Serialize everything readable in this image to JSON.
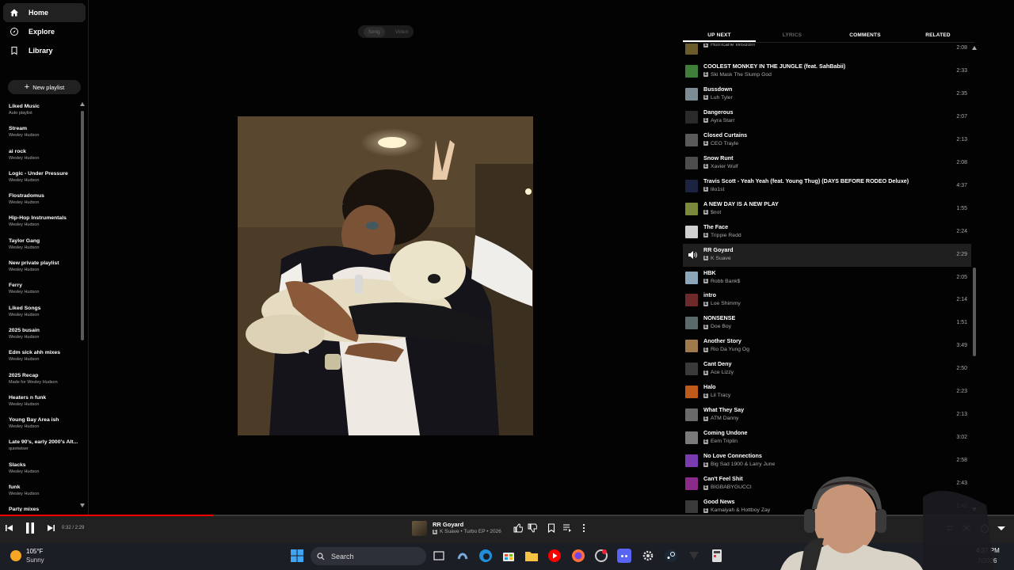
{
  "sidebar": {
    "nav": [
      {
        "label": "Home",
        "icon": "home-icon"
      },
      {
        "label": "Explore",
        "icon": "explore-icon"
      },
      {
        "label": "Library",
        "icon": "library-icon"
      }
    ],
    "new_playlist_label": "New playlist",
    "playlists": [
      {
        "title": "Liked Music",
        "subtitle": "Auto playlist"
      },
      {
        "title": "Stream",
        "subtitle": "Wesley Hudson"
      },
      {
        "title": "ai rock",
        "subtitle": "Wesley Hudson"
      },
      {
        "title": "Logic - Under Pressure",
        "subtitle": "Wesley Hudson"
      },
      {
        "title": "Flostradomus",
        "subtitle": "Wesley Hudson"
      },
      {
        "title": "Hip-Hop Instrumentals",
        "subtitle": "Wesley Hudson"
      },
      {
        "title": "Taylor Gang",
        "subtitle": "Wesley Hudson"
      },
      {
        "title": "New private playlist",
        "subtitle": "Wesley Hudson"
      },
      {
        "title": "Ferry",
        "subtitle": "Wesley Hudson"
      },
      {
        "title": "Liked Songs",
        "subtitle": "Wesley Hudson"
      },
      {
        "title": "2025 busain",
        "subtitle": "Wesley Hudson"
      },
      {
        "title": "Edm sick ahh mixes",
        "subtitle": "Wesley Hudson"
      },
      {
        "title": "2025 Recap",
        "subtitle": "Made for Wesley Hudson"
      },
      {
        "title": "Heaters n funk",
        "subtitle": "Wesley Hudson"
      },
      {
        "title": "Young Bay Area ish",
        "subtitle": "Wesley Hudson"
      },
      {
        "title": "Late 90's, early 2000's Alt...",
        "subtitle": "quietwiser"
      },
      {
        "title": "Slacks",
        "subtitle": "Wesley Hudson"
      },
      {
        "title": "funk",
        "subtitle": "Wesley Hudson"
      },
      {
        "title": "Party mixes",
        "subtitle": "Wesley Hudson"
      }
    ]
  },
  "toggle": {
    "song": "Song",
    "video": "Video"
  },
  "tabs": [
    "UP NEXT",
    "LYRICS",
    "COMMENTS",
    "RELATED"
  ],
  "queue": [
    {
      "title": "",
      "artist": "Hurricane Wisdom",
      "duration": "2:08",
      "thumb": "#6b5a2a"
    },
    {
      "title": "COOLEST MONKEY IN THE JUNGLE (feat. SahBabii)",
      "artist": "Ski Mask The Slump God",
      "duration": "2:33",
      "thumb": "#3f7f3a"
    },
    {
      "title": "Bussdown",
      "artist": "Luh Tyler",
      "duration": "2:35",
      "thumb": "#7b8c95"
    },
    {
      "title": "Dangerous",
      "artist": "Ayra Starr",
      "duration": "2:07",
      "thumb": "#2a2a2a"
    },
    {
      "title": "Closed Curtains",
      "artist": "CEO Trayle",
      "duration": "2:13",
      "thumb": "#5a5a5a"
    },
    {
      "title": "Snow Runt",
      "artist": "Xavier Wulf",
      "duration": "2:08",
      "thumb": "#4d4d4d"
    },
    {
      "title": "Travis Scott - Yeah Yeah (feat. Young Thug) (DAYS BEFORE RODEO Deluxe)",
      "artist": "lilo1st",
      "duration": "4:37",
      "thumb": "#1c2340"
    },
    {
      "title": "A NEW DAY IS A NEW PLAY",
      "artist": "$not",
      "duration": "1:55",
      "thumb": "#7a8a3a"
    },
    {
      "title": "The Face",
      "artist": "Trippie Redd",
      "duration": "2:24",
      "thumb": "#cfcfcf"
    },
    {
      "title": "RR Goyard",
      "artist": "K Suave",
      "duration": "2:29",
      "thumb": "#1f1f1f"
    },
    {
      "title": "HBK",
      "artist": "Robb Bank$",
      "duration": "2:05",
      "thumb": "#8aa6b8"
    },
    {
      "title": "intro",
      "artist": "Loe Shimmy",
      "duration": "2:14",
      "thumb": "#6e2a2a"
    },
    {
      "title": "NONSENSE",
      "artist": "Doe Boy",
      "duration": "1:51",
      "thumb": "#5a6a6a"
    },
    {
      "title": "Another Story",
      "artist": "Rio Da Yung Og",
      "duration": "3:49",
      "thumb": "#a07a4a"
    },
    {
      "title": "Cant Deny",
      "artist": "Ace Lizzy",
      "duration": "2:50",
      "thumb": "#3a3a3a"
    },
    {
      "title": "Halo",
      "artist": "Lil Tracy",
      "duration": "2:23",
      "thumb": "#c05a1a"
    },
    {
      "title": "What They Say",
      "artist": "ATM Danny",
      "duration": "2:13",
      "thumb": "#6a6a6a"
    },
    {
      "title": "Coming Undone",
      "artist": "Eem Triplin",
      "duration": "3:02",
      "thumb": "#7a7a7a"
    },
    {
      "title": "No Love Connections",
      "artist": "Big Sad 1900 & Larry June",
      "duration": "2:58",
      "thumb": "#7a3ab0"
    },
    {
      "title": "Can't Feel Shit",
      "artist": "BIGBABYGUCCI",
      "duration": "2:43",
      "thumb": "#8a2a8a"
    },
    {
      "title": "Good News",
      "artist": "Kamaiyah & Hottboy Zay",
      "duration": "2:42",
      "thumb": "#3a3a3a"
    }
  ],
  "player": {
    "time": "0:32 / 2:29",
    "progress": 0.21,
    "title": "RR Goyard",
    "subtitle": "K Suave • Turbo EP • 2026"
  },
  "taskbar": {
    "temperature": "105°F",
    "condition": "Sunny",
    "search_label": "Search",
    "time": "4:37 PM",
    "date": "7/2026"
  },
  "colors": {
    "accent": "#ff0000",
    "background": "#030303",
    "panel": "#212121",
    "taskbar": "#1b1e25"
  }
}
